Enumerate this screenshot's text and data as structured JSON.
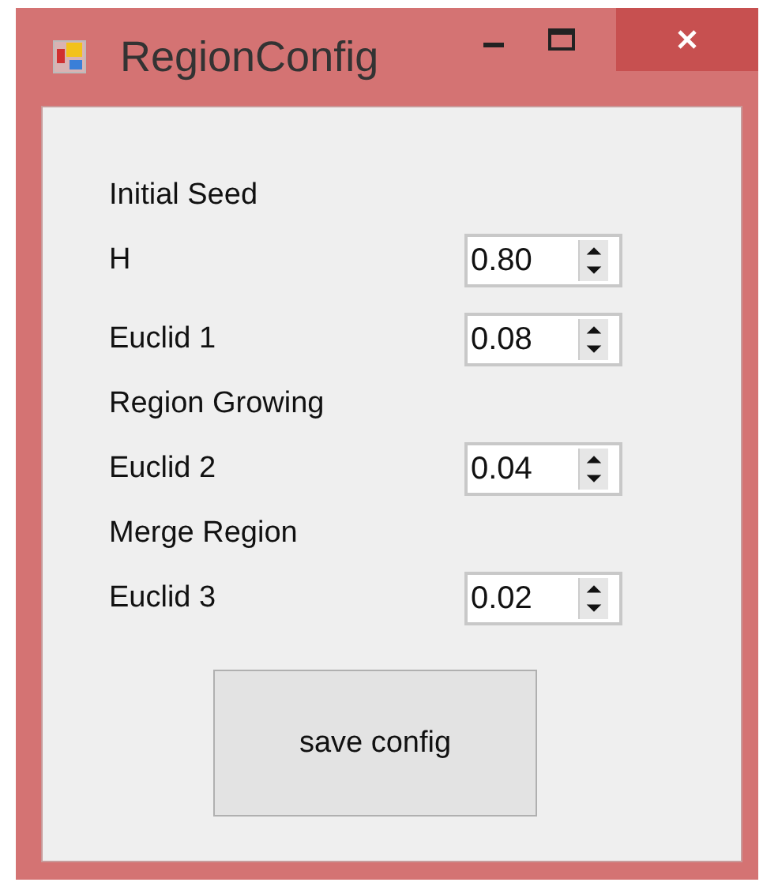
{
  "window": {
    "title": "RegionConfig"
  },
  "items": [
    {
      "kind": "heading",
      "label": "Initial Seed"
    },
    {
      "kind": "field",
      "label": "H",
      "value": "0.80"
    },
    {
      "kind": "field",
      "label": "Euclid 1",
      "value": "0.08"
    },
    {
      "kind": "heading",
      "label": "Region Growing"
    },
    {
      "kind": "field",
      "label": "Euclid 2",
      "value": "0.04"
    },
    {
      "kind": "heading",
      "label": "Merge Region"
    },
    {
      "kind": "field",
      "label": "Euclid 3",
      "value": "0.02"
    }
  ],
  "button": "save config"
}
